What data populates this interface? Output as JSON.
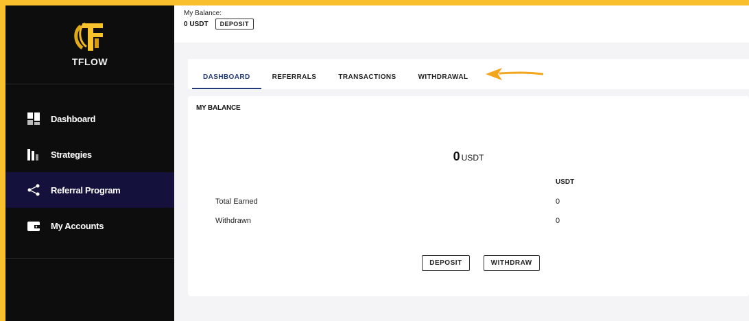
{
  "brand": {
    "name": "TFLOW",
    "accent": "#f9bf2c"
  },
  "sidebar": {
    "items": [
      {
        "label": "Dashboard",
        "icon": "dashboard-icon",
        "active": false
      },
      {
        "label": "Strategies",
        "icon": "bar-chart-icon",
        "active": false
      },
      {
        "label": "Referral Program",
        "icon": "share-icon",
        "active": true
      },
      {
        "label": "My Accounts",
        "icon": "wallet-icon",
        "active": false
      }
    ]
  },
  "topbar": {
    "balance_label": "My Balance:",
    "balance_value": "0 USDT",
    "deposit_label": "DEPOSIT"
  },
  "tabs": [
    {
      "label": "DASHBOARD",
      "active": true
    },
    {
      "label": "REFERRALS",
      "active": false
    },
    {
      "label": "TRANSACTIONS",
      "active": false
    },
    {
      "label": "WITHDRAWAL",
      "active": false
    }
  ],
  "card": {
    "title": "MY BALANCE",
    "amount": "0",
    "unit": "USDT",
    "column_header": "USDT",
    "rows": [
      {
        "label": "Total Earned",
        "value": "0"
      },
      {
        "label": "Withdrawn",
        "value": "0"
      }
    ],
    "deposit_label": "DEPOSIT",
    "withdraw_label": "WITHDRAW"
  }
}
